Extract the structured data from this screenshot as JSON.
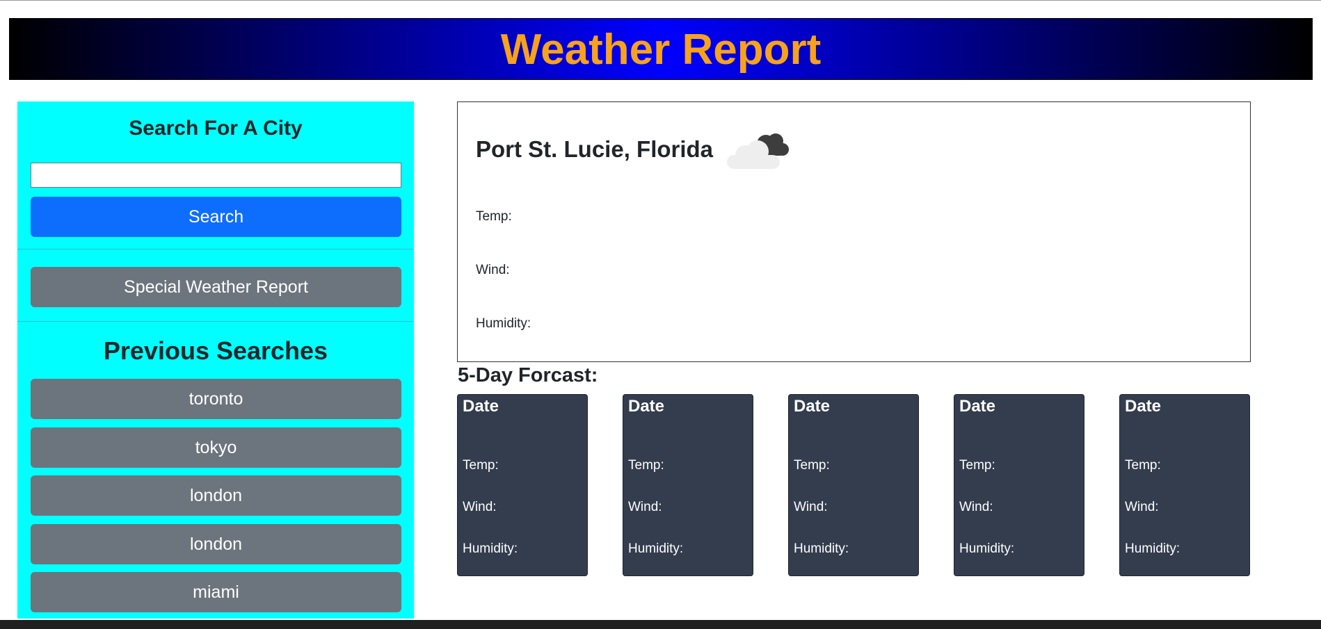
{
  "header": {
    "title": "Weather Report"
  },
  "sidebar": {
    "search_heading": "Search For A City",
    "search_value": "",
    "search_button": "Search",
    "special_button": "Special Weather Report",
    "previous_heading": "Previous Searches",
    "previous_searches": [
      "toronto",
      "tokyo",
      "london",
      "london",
      "miami"
    ]
  },
  "current": {
    "city": "Port St. Lucie, Florida",
    "icon": "cloud-icon",
    "temp_label": "Temp:",
    "wind_label": "Wind:",
    "humidity_label": "Humidity:"
  },
  "forecast": {
    "heading": "5-Day Forcast:",
    "cards": [
      {
        "date": "Date",
        "temp": "Temp:",
        "wind": "Wind:",
        "humidity": "Humidity:"
      },
      {
        "date": "Date",
        "temp": "Temp:",
        "wind": "Wind:",
        "humidity": "Humidity:"
      },
      {
        "date": "Date",
        "temp": "Temp:",
        "wind": "Wind:",
        "humidity": "Humidity:"
      },
      {
        "date": "Date",
        "temp": "Temp:",
        "wind": "Wind:",
        "humidity": "Humidity:"
      },
      {
        "date": "Date",
        "temp": "Temp:",
        "wind": "Wind:",
        "humidity": "Humidity:"
      }
    ]
  },
  "colors": {
    "title": "#f7a21b",
    "banner_center": "#0000ff",
    "sidebar_bg": "#00ffff",
    "primary_button": "#0d6efd",
    "secondary_button": "#6c757d",
    "forecast_card_bg": "#343d4e"
  }
}
